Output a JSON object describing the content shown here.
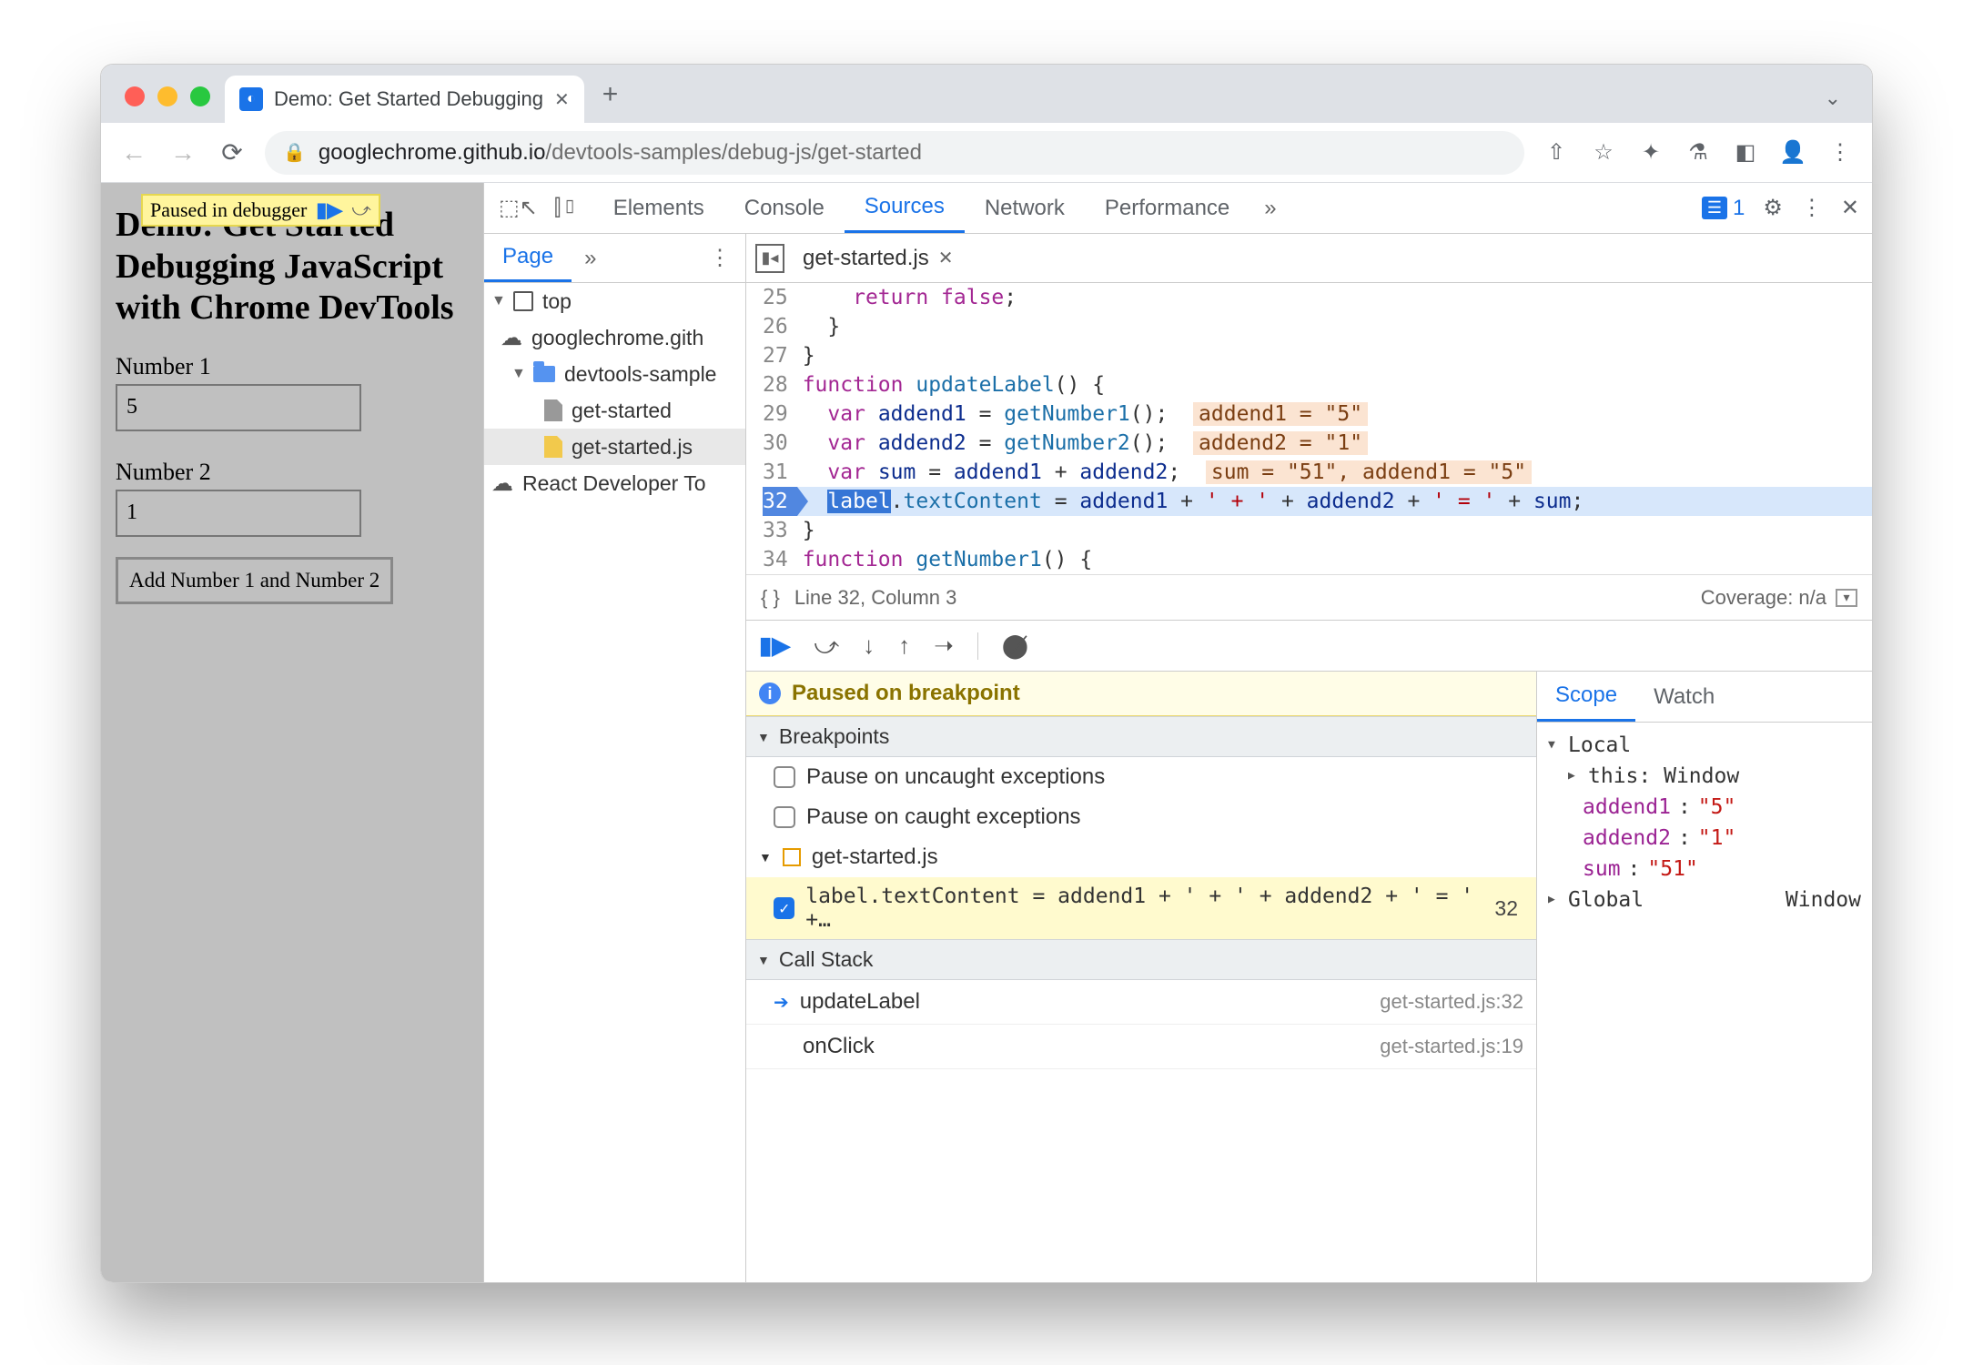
{
  "browser": {
    "tab_title": "Demo: Get Started Debugging",
    "url_domain": "googlechrome.github.io",
    "url_path": "/devtools-samples/debug-js/get-started"
  },
  "page": {
    "paused_text": "Paused in debugger",
    "heading": "Demo: Get Started Debugging JavaScript with Chrome DevTools",
    "label1": "Number 1",
    "value1": "5",
    "label2": "Number 2",
    "value2": "1",
    "button": "Add Number 1 and Number 2"
  },
  "devtools": {
    "tabs": [
      "Elements",
      "Console",
      "Sources",
      "Network",
      "Performance"
    ],
    "active_tab": "Sources",
    "issues_count": "1",
    "nav": {
      "tab": "Page",
      "tree": {
        "top": "top",
        "origin": "googlechrome.gith",
        "folder": "devtools-sample",
        "file_html": "get-started",
        "file_js": "get-started.js",
        "ext": "React Developer To"
      }
    },
    "editor": {
      "filename": "get-started.js",
      "lines": [
        {
          "n": 25,
          "text": "    return false;"
        },
        {
          "n": 26,
          "text": "  }"
        },
        {
          "n": 27,
          "text": "}"
        },
        {
          "n": 28,
          "text": "function updateLabel() {"
        },
        {
          "n": 29,
          "text": "  var addend1 = getNumber1();",
          "hint": "addend1 = \"5\""
        },
        {
          "n": 30,
          "text": "  var addend2 = getNumber2();",
          "hint": "addend2 = \"1\""
        },
        {
          "n": 31,
          "text": "  var sum = addend1 + addend2;",
          "hint": "sum = \"51\", addend1 = \"5\""
        },
        {
          "n": 32,
          "text": "  label.textContent = addend1 + ' + ' + addend2 + ' = ' + sum;",
          "current": true
        },
        {
          "n": 33,
          "text": "}"
        },
        {
          "n": 34,
          "text": "function getNumber1() {"
        }
      ],
      "cursor": "Line 32, Column 3",
      "coverage": "Coverage: n/a"
    },
    "debugger": {
      "banner": "Paused on breakpoint",
      "sections": {
        "breakpoints": "Breakpoints",
        "pause_uncaught": "Pause on uncaught exceptions",
        "pause_caught": "Pause on caught exceptions",
        "bp_file": "get-started.js",
        "bp_text": "label.textContent = addend1 + ' + ' + addend2 + ' = ' +…",
        "bp_line": "32",
        "callstack": "Call Stack",
        "frames": [
          {
            "name": "updateLabel",
            "loc": "get-started.js:32",
            "current": true
          },
          {
            "name": "onClick",
            "loc": "get-started.js:19"
          }
        ]
      }
    },
    "scope": {
      "tabs": [
        "Scope",
        "Watch"
      ],
      "local": "Local",
      "this_label": "this",
      "this_val": "Window",
      "vars": [
        {
          "name": "addend1",
          "val": "\"5\""
        },
        {
          "name": "addend2",
          "val": "\"1\""
        },
        {
          "name": "sum",
          "val": "\"51\""
        }
      ],
      "global": "Global",
      "global_val": "Window"
    }
  }
}
